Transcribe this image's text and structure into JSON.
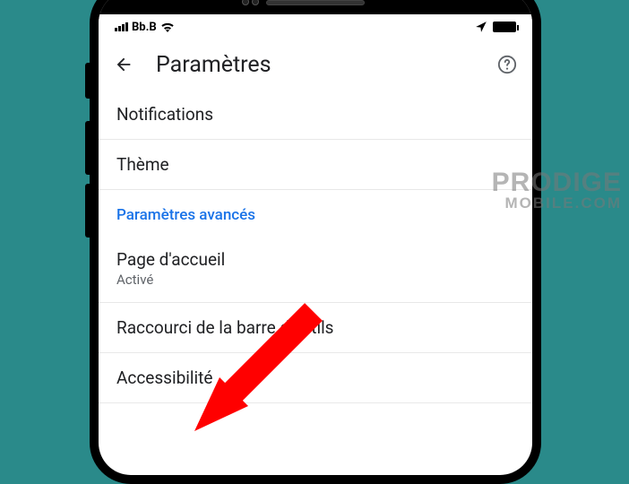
{
  "status": {
    "carrier": "Bb.B"
  },
  "appbar": {
    "title": "Paramètres"
  },
  "list": {
    "notifications": "Notifications",
    "theme": "Thème",
    "section_advanced": "Paramètres avancés",
    "homepage_title": "Page d'accueil",
    "homepage_sub": "Activé",
    "toolbar_shortcut": "Raccourci de la barre d'outils",
    "accessibility": "Accessibilité"
  },
  "watermark": {
    "line1": "PRODIGE",
    "line2": "MOBILE.COM"
  }
}
